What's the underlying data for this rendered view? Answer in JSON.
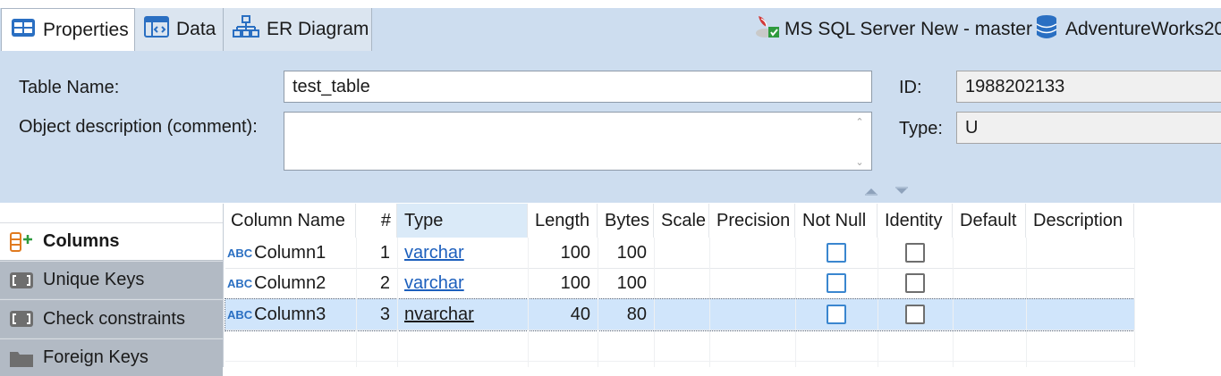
{
  "tabs": [
    {
      "label": "Properties",
      "icon": "properties-icon"
    },
    {
      "label": "Data",
      "icon": "data-icon"
    },
    {
      "label": "ER Diagram",
      "icon": "er-diagram-icon"
    }
  ],
  "connection": {
    "server": "MS SQL Server New - master",
    "database": "AdventureWorks20"
  },
  "properties": {
    "table_name_label": "Table Name:",
    "table_name_value": "test_table",
    "description_label": "Object description (comment):",
    "description_value": "",
    "id_label": "ID:",
    "id_value": "1988202133",
    "type_label": "Type:",
    "type_value": "U"
  },
  "sidebar": {
    "items": [
      {
        "label": "Columns",
        "icon": "columns-icon"
      },
      {
        "label": "Unique Keys",
        "icon": "unique-keys-icon"
      },
      {
        "label": "Check constraints",
        "icon": "check-constraints-icon"
      },
      {
        "label": "Foreign Keys",
        "icon": "foreign-keys-icon"
      }
    ]
  },
  "columns_table": {
    "headers": [
      "Column Name",
      "#",
      "Type",
      "Length",
      "Bytes",
      "Scale",
      "Precision",
      "Not Null",
      "Identity",
      "Default",
      "Description"
    ],
    "rows": [
      {
        "name": "Column1",
        "num": "1",
        "type": "varchar",
        "length": "100",
        "bytes": "100",
        "scale": "",
        "precision": "",
        "not_null": false,
        "identity": false,
        "default": "",
        "description": ""
      },
      {
        "name": "Column2",
        "num": "2",
        "type": "varchar",
        "length": "100",
        "bytes": "100",
        "scale": "",
        "precision": "",
        "not_null": false,
        "identity": false,
        "default": "",
        "description": ""
      },
      {
        "name": "Column3",
        "num": "3",
        "type": "nvarchar",
        "length": "40",
        "bytes": "80",
        "scale": "",
        "precision": "",
        "not_null": false,
        "identity": false,
        "default": "",
        "description": ""
      }
    ],
    "selected_row": 3
  },
  "colors": {
    "panel_bg": "#cdddef",
    "selected_row": "#d0e5fb",
    "link": "#1c5fbd",
    "checkbox_blue": "#3a86cf"
  }
}
